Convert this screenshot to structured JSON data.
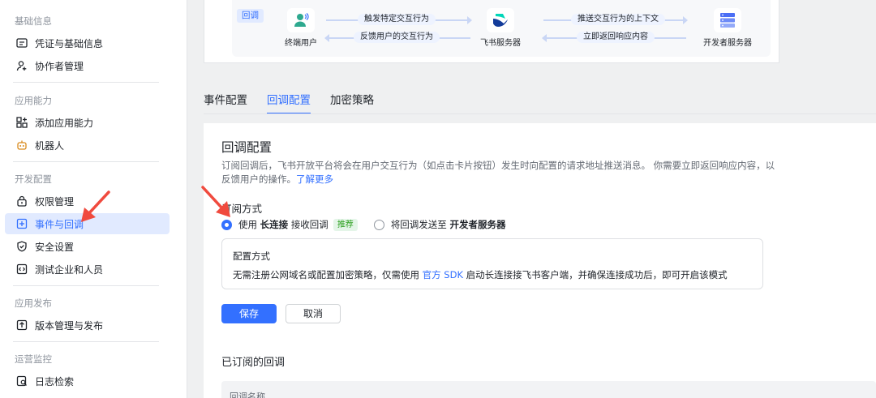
{
  "sidebar": {
    "sections": [
      {
        "title": "基础信息",
        "items": [
          {
            "label": "凭证与基础信息",
            "icon": "credential-icon"
          },
          {
            "label": "协作者管理",
            "icon": "user-plus-icon"
          }
        ]
      },
      {
        "title": "应用能力",
        "items": [
          {
            "label": "添加应用能力",
            "icon": "grid-add-icon"
          },
          {
            "label": "机器人",
            "icon": "robot-icon"
          }
        ]
      },
      {
        "title": "开发配置",
        "items": [
          {
            "label": "权限管理",
            "icon": "lock-icon"
          },
          {
            "label": "事件与回调",
            "icon": "event-icon",
            "active": true
          },
          {
            "label": "安全设置",
            "icon": "shield-icon"
          },
          {
            "label": "测试企业和人员",
            "icon": "code-icon"
          }
        ]
      },
      {
        "title": "应用发布",
        "items": [
          {
            "label": "版本管理与发布",
            "icon": "upload-icon"
          }
        ]
      },
      {
        "title": "运营监控",
        "items": [
          {
            "label": "日志检索",
            "icon": "log-search-icon"
          }
        ]
      }
    ]
  },
  "flow": {
    "tag": "回调",
    "nodes": [
      "终端用户",
      "飞书服务器",
      "开发者服务器"
    ],
    "pills": [
      "触发特定交互行为",
      "反馈用户的交互行为",
      "推送交互行为的上下文",
      "立即返回响应内容"
    ]
  },
  "tabs": [
    "事件配置",
    "回调配置",
    "加密策略"
  ],
  "active_tab": 1,
  "panel": {
    "title": "回调配置",
    "desc": "订阅回调后，飞书开放平台将会在用户交互行为（如点击卡片按钮）发生时向配置的请求地址推送消息。 你需要立即返回响应内容，以反馈用户的操作。",
    "learn_more": "了解更多",
    "subscribe_title": "订阅方式",
    "option1": {
      "prefix": "使用",
      "bold": "长连接",
      "suffix": "接收回调",
      "badge": "推荐"
    },
    "option2": {
      "prefix": "将回调发送至",
      "bold": "开发者服务器"
    },
    "mode_title": "配置方式",
    "mode_desc_prefix": "无需注册公网域名或配置加密策略，仅需使用",
    "mode_desc_link": "官方 SDK",
    "mode_desc_suffix": "启动长连接接飞书客户端，并确保连接成功后，即可开启该模式",
    "save": "保存",
    "cancel": "取消",
    "subscribed_title": "已订阅的回调",
    "table_header": "回调名称"
  },
  "colors": {
    "accent": "#3370ff",
    "annotation": "#f04a3e",
    "badge_green": "#2ea121"
  }
}
